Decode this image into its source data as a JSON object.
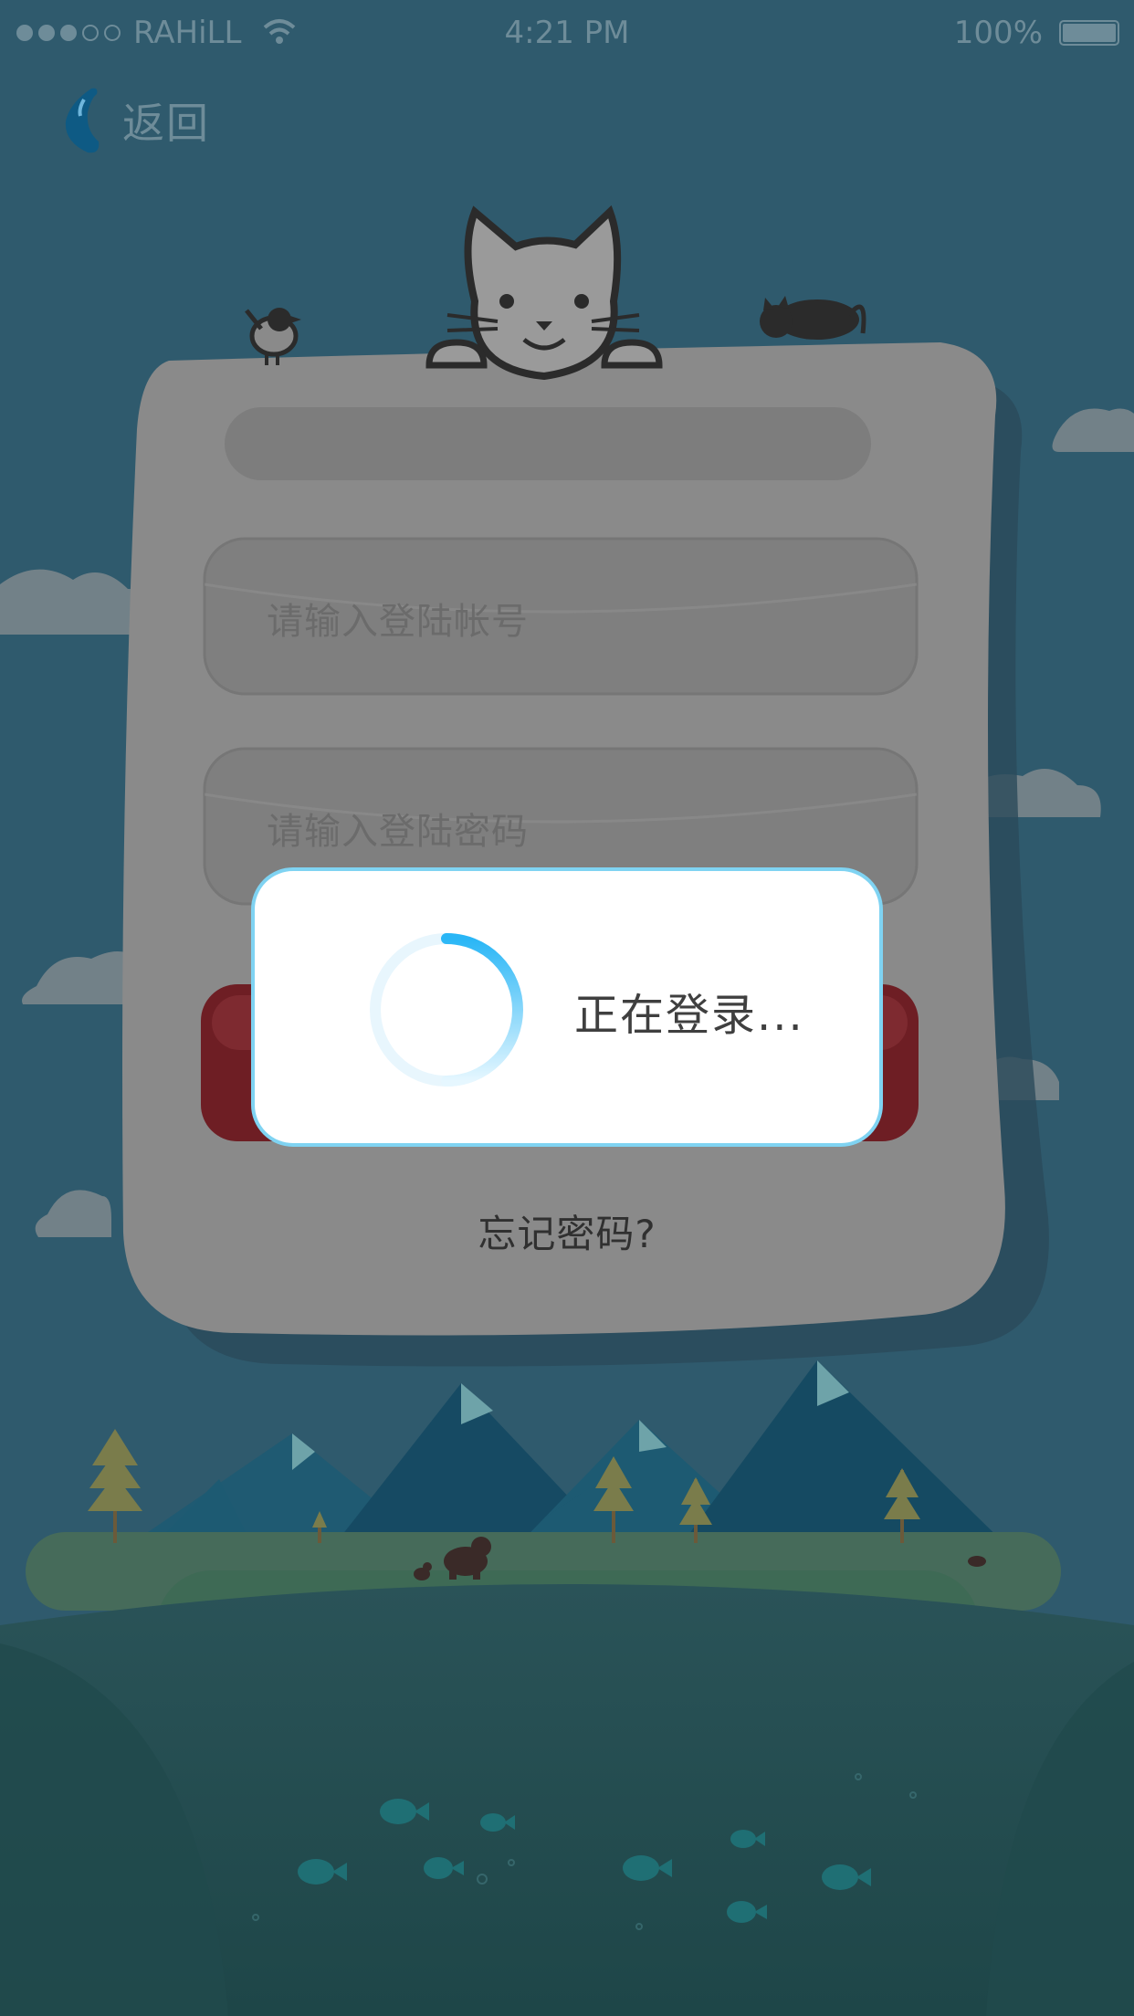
{
  "status_bar": {
    "carrier": "RAHiLL",
    "time": "4:21 PM",
    "battery": "100%"
  },
  "nav": {
    "back_label": "返回"
  },
  "login_form": {
    "account_placeholder": "请输入登陆帐号",
    "password_placeholder": "请输入登陆密码",
    "forgot_password": "忘记密码?"
  },
  "loading_dialog": {
    "message": "正在登录...",
    "accent_color": "#29b6f6"
  },
  "icons": [
    "back-icon",
    "wifi-icon",
    "battery-icon",
    "cat-icon",
    "bird-icon",
    "sleeping-cat-icon",
    "cloud-icon",
    "bear-icon",
    "fish-icon",
    "tree-icon",
    "mountain-icon"
  ]
}
